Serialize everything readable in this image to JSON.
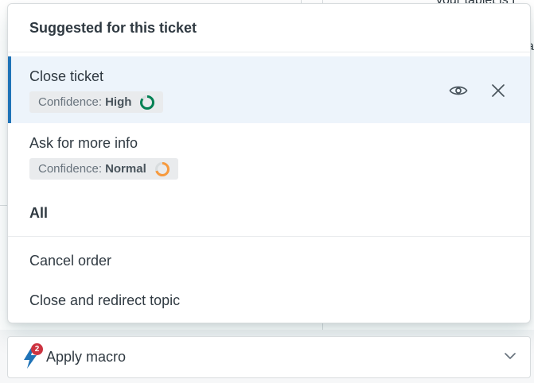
{
  "background": {
    "top_text": "your tablet is f",
    "right_text": "a"
  },
  "menu": {
    "header": "Suggested for this ticket",
    "suggestions": [
      {
        "title": "Close ticket",
        "confidence_label": "Confidence:",
        "confidence_level": "High",
        "ring_color": "#038153",
        "ring_fraction": 0.85
      },
      {
        "title": "Ask for more info",
        "confidence_label": "Confidence:",
        "confidence_level": "Normal",
        "ring_color": "#f79a3e",
        "ring_fraction": 0.7
      }
    ],
    "all_label": "All",
    "items": [
      "Cancel order",
      "Close and redirect topic"
    ]
  },
  "apply_bar": {
    "label": "Apply macro",
    "badge_count": "2",
    "bolt_color": "#1f73b7",
    "icon": "lightning-bolt-icon"
  },
  "colors": {
    "accent": "#1f73b7",
    "active_bg": "#edf4fb",
    "badge_red": "#cc3340"
  }
}
